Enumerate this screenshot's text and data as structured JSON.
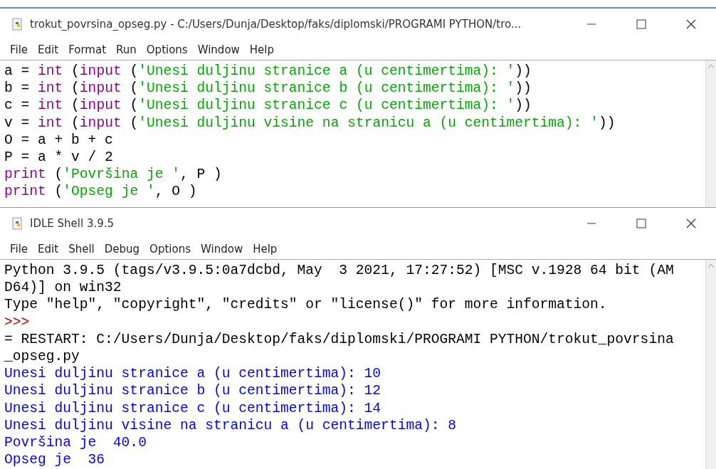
{
  "editor_window": {
    "title": "trokut_povrsina_opseg.py - C:/Users/Dunja/Desktop/faks/diplomski/PROGRAMI PYTHON/tro...",
    "menu": [
      "File",
      "Edit",
      "Format",
      "Run",
      "Options",
      "Window",
      "Help"
    ],
    "lines": [
      [
        {
          "kind": "plain",
          "text": "a = "
        },
        {
          "kind": "builtin",
          "text": "int"
        },
        {
          "kind": "plain",
          "text": " ("
        },
        {
          "kind": "builtin",
          "text": "input"
        },
        {
          "kind": "plain",
          "text": " ("
        },
        {
          "kind": "string",
          "text": "'Unesi duljinu stranice a (u centimertima): '"
        },
        {
          "kind": "plain",
          "text": "))"
        }
      ],
      [
        {
          "kind": "plain",
          "text": "b = "
        },
        {
          "kind": "builtin",
          "text": "int"
        },
        {
          "kind": "plain",
          "text": " ("
        },
        {
          "kind": "builtin",
          "text": "input"
        },
        {
          "kind": "plain",
          "text": " ("
        },
        {
          "kind": "string",
          "text": "'Unesi duljinu stranice b (u centimertima): '"
        },
        {
          "kind": "plain",
          "text": "))"
        }
      ],
      [
        {
          "kind": "plain",
          "text": "c = "
        },
        {
          "kind": "builtin",
          "text": "int"
        },
        {
          "kind": "plain",
          "text": " ("
        },
        {
          "kind": "builtin",
          "text": "input"
        },
        {
          "kind": "plain",
          "text": " ("
        },
        {
          "kind": "string",
          "text": "'Unesi duljinu stranice c (u centimertima): '"
        },
        {
          "kind": "plain",
          "text": "))"
        }
      ],
      [
        {
          "kind": "plain",
          "text": "v = "
        },
        {
          "kind": "builtin",
          "text": "int"
        },
        {
          "kind": "plain",
          "text": " ("
        },
        {
          "kind": "builtin",
          "text": "input"
        },
        {
          "kind": "plain",
          "text": " ("
        },
        {
          "kind": "string",
          "text": "'Unesi duljinu visine na stranicu a (u centimertima): '"
        },
        {
          "kind": "plain",
          "text": "))"
        }
      ],
      [
        {
          "kind": "plain",
          "text": "O = a + b + c"
        }
      ],
      [
        {
          "kind": "plain",
          "text": "P = a * v / 2"
        }
      ],
      [
        {
          "kind": "builtin",
          "text": "print"
        },
        {
          "kind": "plain",
          "text": " ("
        },
        {
          "kind": "string",
          "text": "'Površina je '"
        },
        {
          "kind": "plain",
          "text": ", P )"
        }
      ],
      [
        {
          "kind": "builtin",
          "text": "print"
        },
        {
          "kind": "plain",
          "text": " ("
        },
        {
          "kind": "string",
          "text": "'Opseg je '"
        },
        {
          "kind": "plain",
          "text": ", O )"
        }
      ]
    ]
  },
  "shell_window": {
    "title": "IDLE Shell 3.9.5",
    "menu": [
      "File",
      "Edit",
      "Shell",
      "Debug",
      "Options",
      "Window",
      "Help"
    ],
    "lines": [
      {
        "kind": "output",
        "text": "Python 3.9.5 (tags/v3.9.5:0a7dcbd, May  3 2021, 17:27:52) [MSC v.1928 64 bit (AM"
      },
      {
        "kind": "output",
        "text": "D64)] on win32"
      },
      {
        "kind": "output",
        "text": "Type \"help\", \"copyright\", \"credits\" or \"license()\" for more information."
      },
      {
        "kind": "prompt",
        "text": ">>>"
      },
      {
        "kind": "output",
        "text": "= RESTART: C:/Users/Dunja/Desktop/faks/diplomski/PROGRAMI PYTHON/trokut_povrsina"
      },
      {
        "kind": "output",
        "text": "_opseg.py"
      },
      {
        "kind": "stdout",
        "text": "Unesi duljinu stranice a (u centimertima): 10"
      },
      {
        "kind": "stdout",
        "text": "Unesi duljinu stranice b (u centimertima): 12"
      },
      {
        "kind": "stdout",
        "text": "Unesi duljinu stranice c (u centimertima): 14"
      },
      {
        "kind": "stdout",
        "text": "Unesi duljinu visine na stranicu a (u centimertima): 8"
      },
      {
        "kind": "stdout",
        "text": "Površina je  40.0"
      },
      {
        "kind": "stdout",
        "text": "Opseg je  36"
      }
    ]
  }
}
